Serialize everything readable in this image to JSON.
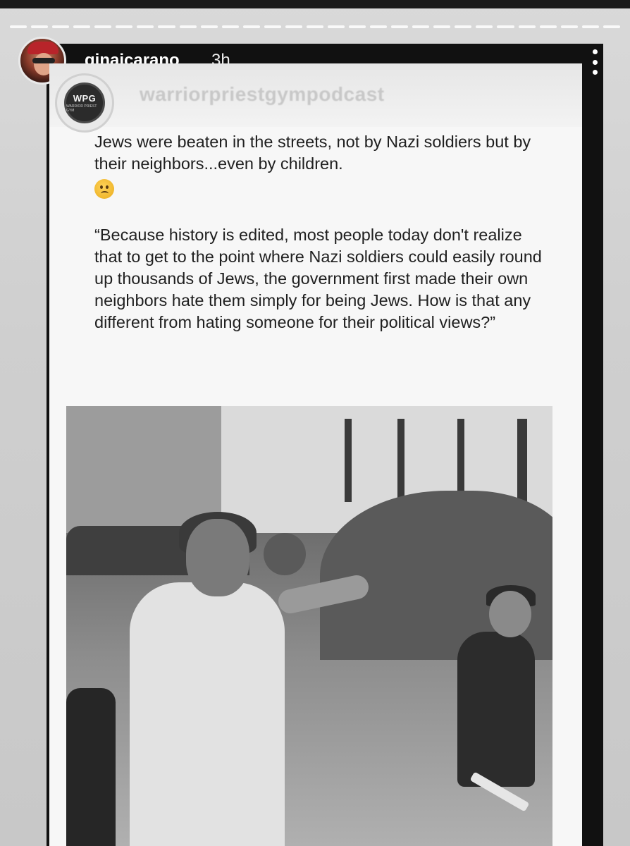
{
  "story": {
    "progress_segments": 29,
    "user": {
      "username": "ginajcarano",
      "time_ago": "3h",
      "avatar": "user-avatar"
    },
    "menu_icon": "more-vertical-icon"
  },
  "repost": {
    "source": {
      "logo_text": "WPG",
      "logo_subtext": "WARRIOR PRIEST GYM",
      "name": "warriorpriestgympodcast"
    },
    "paragraph1": "Jews were beaten in the streets, not by Nazi soldiers but by their neighbors...even by children.",
    "emoji": "sad-face-emoji",
    "paragraph2": "“Because history is edited, most people today don't realize that to get to the point where Nazi soldiers could easily round up thousands of Jews, the government first made their own neighbors hate them simply for being Jews. How is that any different from hating someone for their political views?”",
    "photo": "black-and-white historical street photo"
  },
  "colors": {
    "frame": "#111111",
    "card_bg": "#f7f7f7",
    "text": "#1f1f1f",
    "username": "#ffffff"
  }
}
